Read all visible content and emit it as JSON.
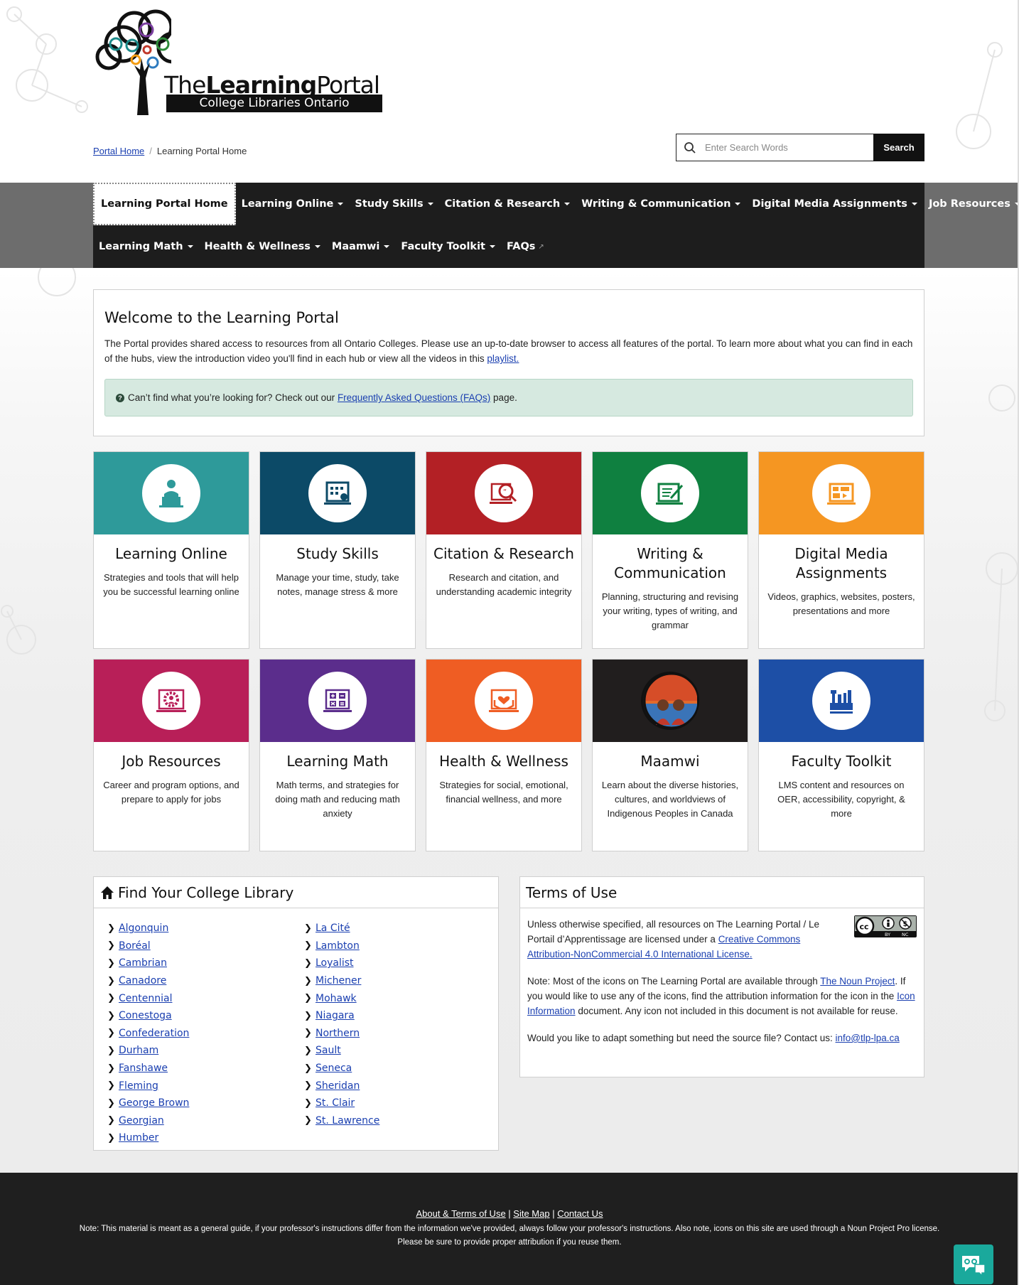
{
  "header": {
    "logo_text_a": "The",
    "logo_text_b": "Learning",
    "logo_text_c": "Portal",
    "logo_subtitle": "College Libraries Ontario"
  },
  "breadcrumb": {
    "home": "Portal Home",
    "current": "Learning Portal Home"
  },
  "search": {
    "placeholder": "Enter Search Words",
    "button": "Search"
  },
  "nav": {
    "row1": [
      "Learning Portal Home",
      "Learning Online",
      "Study Skills",
      "Citation & Research",
      "Writing & Communication",
      "Digital Media Assignments",
      "Job Resources"
    ],
    "row2": [
      "Learning Math",
      "Health & Wellness",
      "Maamwi",
      "Faculty Toolkit",
      "FAQs"
    ]
  },
  "welcome": {
    "title": "Welcome to the Learning Portal",
    "text": "The Portal provides shared access to resources from all Ontario Colleges. Please use an up-to-date browser to access all features of the portal. To learn more about what you can find in each of the hubs, view the introduction video you'll find in each hub or view all the videos in this",
    "link": "playlist.",
    "alert_text": "Can’t find what you’re looking for? Check out our",
    "alert_link": "Frequently Asked Questions (FAQs)",
    "alert_tail": "page."
  },
  "hubs": [
    {
      "title": "Learning Online",
      "desc": "Strategies and tools that will help you be successful learning online",
      "color": "#2e9a9a",
      "icon": "laptop-person-icon"
    },
    {
      "title": "Study Skills",
      "desc": "Manage your time, study, take notes, manage stress & more",
      "color": "#0c4a67",
      "icon": "calendar-laptop-icon"
    },
    {
      "title": "Citation & Research",
      "desc": "Research and citation, and understanding academic integrity",
      "color": "#b32025",
      "icon": "magnify-quote-icon"
    },
    {
      "title": "Writing & Communication",
      "desc": "Planning, structuring and revising your writing, types of writing, and grammar",
      "color": "#0f8040",
      "icon": "writing-laptop-icon"
    },
    {
      "title": "Digital Media Assignments",
      "desc": "Videos, graphics, websites, posters, presentations and more",
      "color": "#f59622",
      "icon": "media-laptop-icon"
    },
    {
      "title": "Job Resources",
      "desc": "Career and program options, and prepare to apply for jobs",
      "color": "#b81f58",
      "icon": "gear-person-icon"
    },
    {
      "title": "Learning Math",
      "desc": "Math terms, and strategies for doing math and reducing math anxiety",
      "color": "#5b2d8c",
      "icon": "calculator-laptop-icon"
    },
    {
      "title": "Health & Wellness",
      "desc": "Strategies for social, emotional, financial wellness, and more",
      "color": "#ef5d23",
      "icon": "heart-hands-icon"
    },
    {
      "title": "Maamwi",
      "desc": "Learn about the diverse histories, cultures, and worldviews of Indigenous Peoples in Canada",
      "color": "#211e1e",
      "icon": "indigenous-art-icon"
    },
    {
      "title": "Faculty Toolkit",
      "desc": "LMS content and resources on OER, accessibility, copyright, & more",
      "color": "#1d4fa6",
      "icon": "toolbox-icon"
    }
  ],
  "colleges": {
    "title": "Find Your College Library",
    "col1": [
      "Algonquin",
      "Boréal",
      "Cambrian",
      "Canadore",
      "Centennial",
      "Conestoga",
      "Confederation",
      "Durham",
      "Fanshawe",
      "Fleming",
      "George Brown",
      "Georgian",
      "Humber"
    ],
    "col2": [
      "La Cité",
      "Lambton",
      "Loyalist",
      "Michener",
      "Mohawk",
      "Niagara",
      "Northern",
      "Sault",
      "Seneca",
      "Sheridan",
      "St. Clair",
      "St. Lawrence"
    ]
  },
  "terms": {
    "title": "Terms of Use",
    "p1": "Unless otherwise specified, all resources on The Learning Portal / Le Portail d’Apprentissage are licensed under a",
    "p1_link": "Creative Commons Attribution-NonCommercial 4.0 International License.",
    "p2a": "Note: Most of the icons on The Learning Portal are available through",
    "p2_link1": "The Noun Project",
    "p2b": ". If you would like to use any of the icons, find the attribution information for the icon in the",
    "p2_link2": "Icon Information",
    "p2c": "document. Any icon not included in this document is not available for reuse.",
    "p3": "Would you like to adapt something but need the source file? Contact us:",
    "p3_link": "info@tlp-lpa.ca",
    "badge_by": "BY",
    "badge_nc": "NC"
  },
  "footer": {
    "link1": "About & Terms of Use",
    "link2": "Site Map",
    "link3": "Contact Us",
    "note1": "Note: This material is meant as a general guide, if your professor's instructions differ from the information we've provided, always follow your professor's instructions. Also note, icons on this site are used through a Noun Project Pro license.",
    "note2": "Please be sure to provide proper attribution if you reuse them."
  }
}
